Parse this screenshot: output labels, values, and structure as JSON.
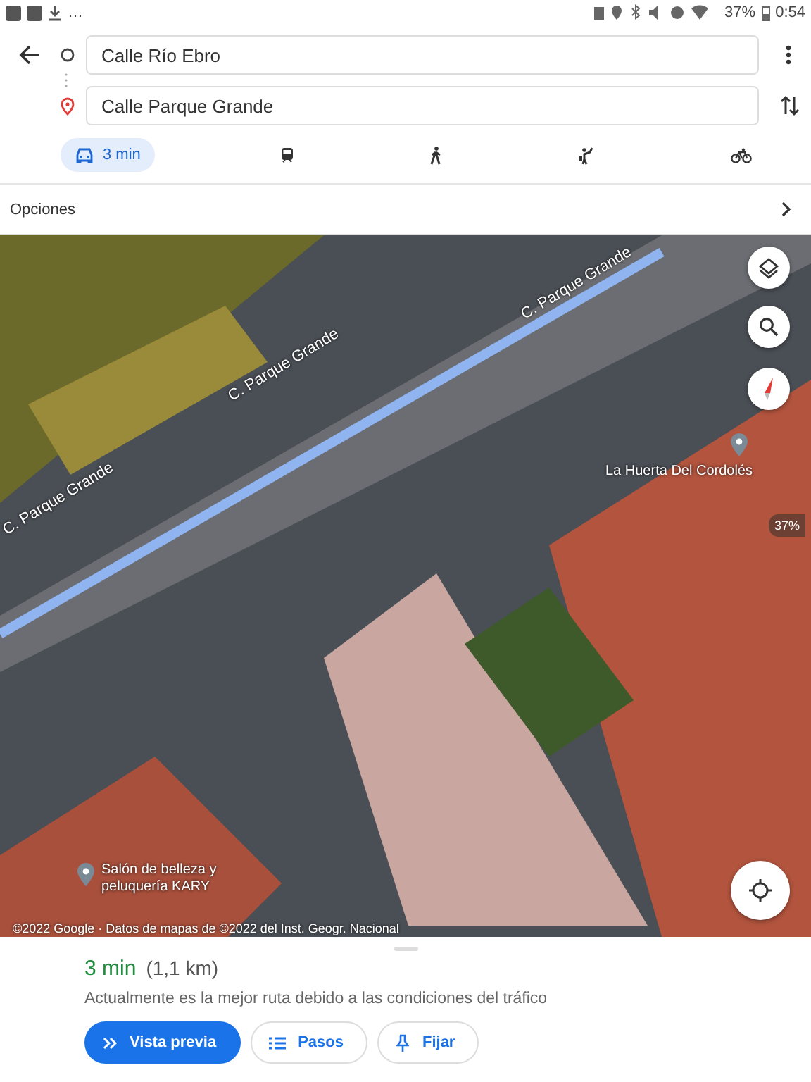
{
  "status_bar": {
    "notifications": "…",
    "battery": "37%",
    "time": "0:54"
  },
  "route": {
    "origin": {
      "value": "Calle Río Ebro"
    },
    "destination": {
      "value": "Calle Parque Grande"
    }
  },
  "modes": [
    {
      "kind": "car",
      "label": "3 min",
      "selected": true
    },
    {
      "kind": "transit",
      "selected": false
    },
    {
      "kind": "walk",
      "selected": false
    },
    {
      "kind": "ride",
      "selected": false
    },
    {
      "kind": "bike",
      "selected": false
    }
  ],
  "options": {
    "label": "Opciones"
  },
  "map": {
    "street_labels": [
      {
        "text": "C. Parque Grande"
      },
      {
        "text": "C. Parque Grande"
      },
      {
        "text": "C. Parque Grande"
      }
    ],
    "places": [
      {
        "name": "La Huerta Del Cordolés"
      },
      {
        "name": "Salón de belleza y\npeluquería KARY"
      }
    ],
    "zoom_badge": "37%",
    "copyright": "©2022 Google · Datos de mapas de ©2022 del Inst. Geogr. Nacional"
  },
  "summary": {
    "duration": "3 min",
    "distance": "(1,1 km)",
    "description": "Actualmente es la mejor ruta debido a las condiciones del tráfico"
  },
  "actions": [
    {
      "kind": "preview",
      "label": "Vista previa"
    },
    {
      "kind": "steps",
      "label": "Pasos"
    },
    {
      "kind": "pin",
      "label": "Fijar"
    }
  ]
}
